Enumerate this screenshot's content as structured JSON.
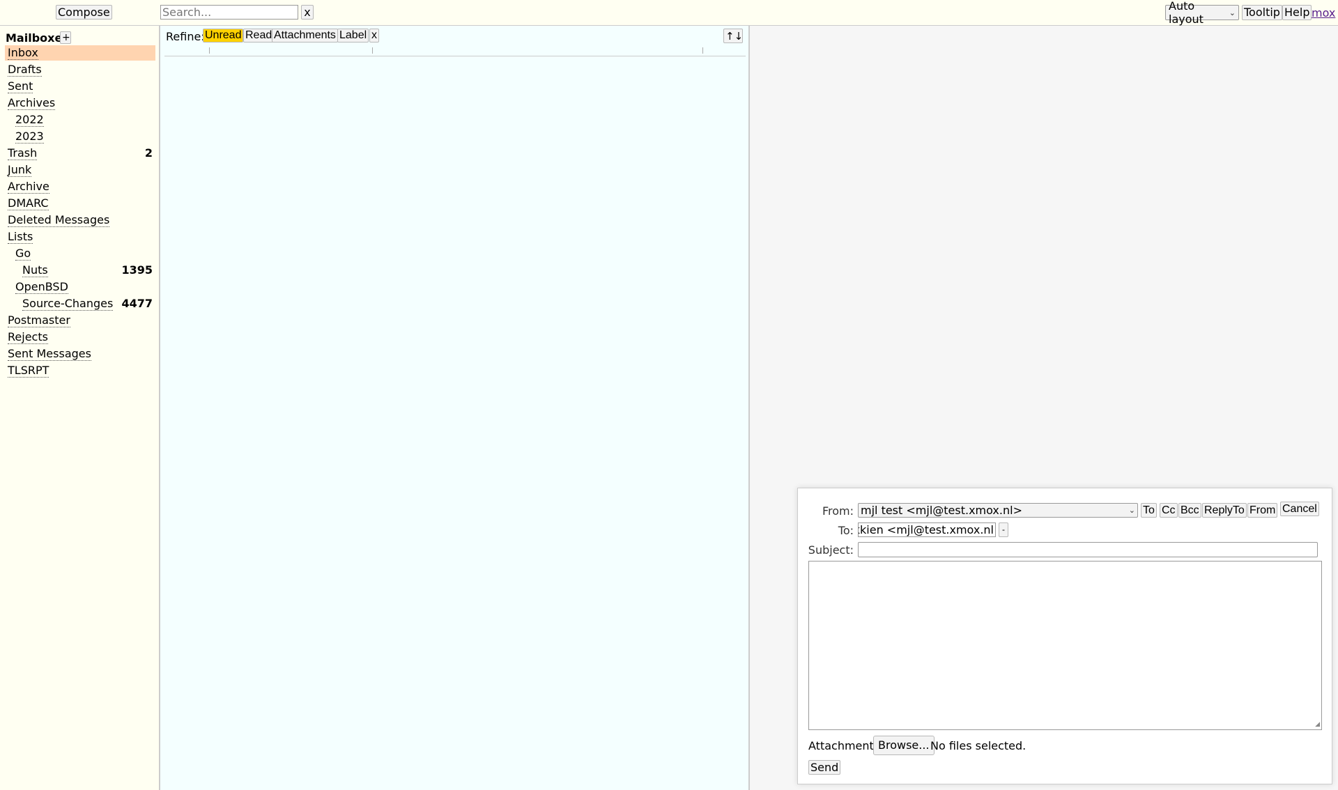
{
  "topbar": {
    "compose_label": "Compose",
    "search_placeholder": "Search...",
    "search_clear_label": "x",
    "layout_value": "Auto layout",
    "tooltip_label": "Tooltip",
    "help_label": "Help",
    "mox_link": "mox"
  },
  "sidebar": {
    "title": "Mailboxes",
    "add_label": "+",
    "items": [
      {
        "label": "Inbox",
        "count": ""
      },
      {
        "label": "Drafts",
        "count": ""
      },
      {
        "label": "Sent",
        "count": ""
      },
      {
        "label": "Archives",
        "count": ""
      },
      {
        "label": "2022",
        "count": ""
      },
      {
        "label": "2023",
        "count": ""
      },
      {
        "label": "Trash",
        "count": "2"
      },
      {
        "label": "Junk",
        "count": ""
      },
      {
        "label": "Archive",
        "count": ""
      },
      {
        "label": "DMARC",
        "count": ""
      },
      {
        "label": "Deleted Messages",
        "count": ""
      },
      {
        "label": "Lists",
        "count": ""
      },
      {
        "label": "Go",
        "count": ""
      },
      {
        "label": "Nuts",
        "count": "1395"
      },
      {
        "label": "OpenBSD",
        "count": ""
      },
      {
        "label": "Source-Changes",
        "count": "4477"
      },
      {
        "label": "Postmaster",
        "count": ""
      },
      {
        "label": "Rejects",
        "count": ""
      },
      {
        "label": "Sent Messages",
        "count": ""
      },
      {
        "label": "TLSRPT",
        "count": ""
      }
    ]
  },
  "list": {
    "refine_label": "Refine:",
    "refine_unread": "Unread",
    "refine_read": "Read",
    "refine_attachments": "Attachments",
    "refine_label_btn": "Label",
    "refine_clear": "x",
    "sort_label": "↑↓"
  },
  "compose": {
    "from_label": "From:",
    "from_value": "mjl test <mjl@test.xmox.nl>",
    "to_btn": "To",
    "cc_btn": "Cc",
    "bcc_btn": "Bcc",
    "replyto_btn": "ReplyTo",
    "from_btn": "From",
    "cancel_btn": "Cancel",
    "to_label": "To:",
    "to_value": "Mechiel Lukkien <mjl@test.xmox.nl>",
    "to_remove": "-",
    "subject_label": "Subject:",
    "subject_value": "",
    "attachments_label": "Attachments",
    "browse_label": "Browse...",
    "no_files": "No files selected.",
    "send_label": "Send"
  },
  "colors": {
    "selected_mailbox": "#ffd4b0",
    "active_filter": "#ffd200",
    "topbar_bg": "#fffff2",
    "list_bg": "#f4ffff"
  }
}
